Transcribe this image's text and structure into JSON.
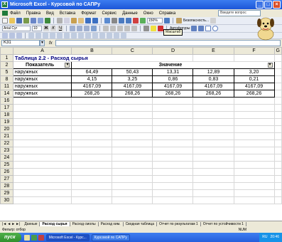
{
  "window": {
    "title": "Microsoft Excel - Курсовой по САПРу"
  },
  "menu": [
    "Файл",
    "Правка",
    "Вид",
    "Вставка",
    "Формат",
    "Сервис",
    "Данные",
    "Окно",
    "Справка"
  ],
  "help_placeholder": "Введите вопрос",
  "toolbar": {
    "zoom": "150%",
    "security": "Безопасность...",
    "font": "Arial Cyr",
    "font_size": "10",
    "autoformat": "Автофигуры"
  },
  "tooltip": "Масштаб",
  "formula": {
    "namebox": "K31",
    "fx": "fx",
    "value": ""
  },
  "columns": [
    "A",
    "B",
    "C",
    "D",
    "E",
    "F",
    "G"
  ],
  "sheet": {
    "title": "Таблица 2.2 - Расход сырья",
    "header_indicator": "Показатель",
    "header_value": "Значение",
    "rows": [
      {
        "row": "1",
        "type": "title"
      },
      {
        "row": "2",
        "type": "header"
      },
      {
        "row": "5",
        "type": "data",
        "cells": [
          "наружных",
          "64,49",
          "50,43",
          "13,31",
          "12,89",
          "3,20"
        ]
      },
      {
        "row": "8",
        "type": "data",
        "cells": [
          "наружных",
          "4,15",
          "3,25",
          "0,86",
          "0,83",
          "0,21"
        ]
      },
      {
        "row": "11",
        "type": "data",
        "cells": [
          "наружных",
          "4167,09",
          "4167,09",
          "4167,09",
          "4167,09",
          "4167,09"
        ]
      },
      {
        "row": "14",
        "type": "data",
        "cells": [
          "наружных",
          "268,26",
          "268,26",
          "268,26",
          "268,26",
          "268,26"
        ]
      },
      {
        "row": "16"
      },
      {
        "row": "17"
      },
      {
        "row": "18"
      },
      {
        "row": "19"
      },
      {
        "row": "20"
      },
      {
        "row": "21"
      },
      {
        "row": "22"
      },
      {
        "row": "23"
      },
      {
        "row": "24"
      },
      {
        "row": "25"
      },
      {
        "row": "26"
      },
      {
        "row": "27"
      },
      {
        "row": "28"
      },
      {
        "row": "29"
      },
      {
        "row": "30"
      }
    ]
  },
  "sheet_tabs": [
    "Данные",
    "Расход сырья",
    "Расход смолы",
    "Расход хим.",
    "Сводная таблица",
    "Отчет по результатам 1",
    "Отчет по устойчивости 1"
  ],
  "active_tab": "Расход сырья",
  "status": {
    "left": "Фильтр: отбор",
    "num": "NUM"
  },
  "taskbar": {
    "start": "пуск",
    "apps": [
      "Microsoft Excel - Курс...",
      "Курсовой по САПРу"
    ],
    "lang": "RU",
    "clock": "20:46"
  },
  "colors": {
    "title_text": "#000080",
    "titlebar": "#1c55d8",
    "taskbar": "#245edc",
    "start": "#2f8f2c"
  }
}
